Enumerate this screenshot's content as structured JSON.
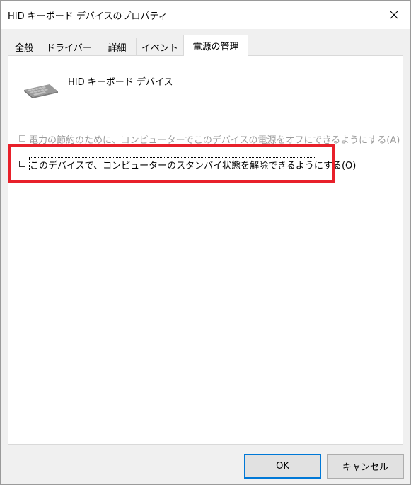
{
  "window": {
    "title": "HID キーボード デバイスのプロパティ"
  },
  "tabs": [
    {
      "label": "全般",
      "active": false
    },
    {
      "label": "ドライバー",
      "active": false
    },
    {
      "label": "詳細",
      "active": false
    },
    {
      "label": "イベント",
      "active": false
    },
    {
      "label": "電源の管理",
      "active": true
    }
  ],
  "device": {
    "name": "HID キーボード デバイス",
    "icon": "keyboard-icon"
  },
  "options": [
    {
      "label": "電力の節約のために、コンピューターでこのデバイスの電源をオフにできるようにする(A)",
      "checked": false,
      "enabled": false
    },
    {
      "label": "このデバイスで、コンピューターのスタンバイ状態を解除できるようにする(O)",
      "checked": false,
      "enabled": true
    }
  ],
  "buttons": {
    "ok": "OK",
    "cancel": "キャンセル"
  },
  "colors": {
    "highlight": "#e8202a",
    "default_button_border": "#0078d7",
    "disabled_text": "#9b9b9b"
  }
}
